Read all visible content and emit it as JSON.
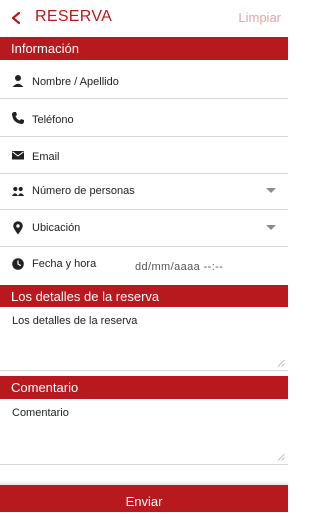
{
  "header": {
    "title": "RESERVA",
    "clear_label": "Limpiar"
  },
  "sections": {
    "info": "Información",
    "details": "Los detalles de la reserva",
    "comment": "Comentario"
  },
  "fields": {
    "name": "Nombre / Apellido",
    "phone": "Teléfono",
    "email": "Email",
    "people": "Número de personas",
    "location": "Ubicación",
    "datetime": "Fecha y hora",
    "datetime_value": "dd/mm/aaaa --:--",
    "details_placeholder": "Los detalles de la reserva",
    "comment_placeholder": "Comentario"
  },
  "submit_label": "Enviar",
  "colors": {
    "accent": "#b7191f",
    "clear": "#e8a3a6"
  }
}
